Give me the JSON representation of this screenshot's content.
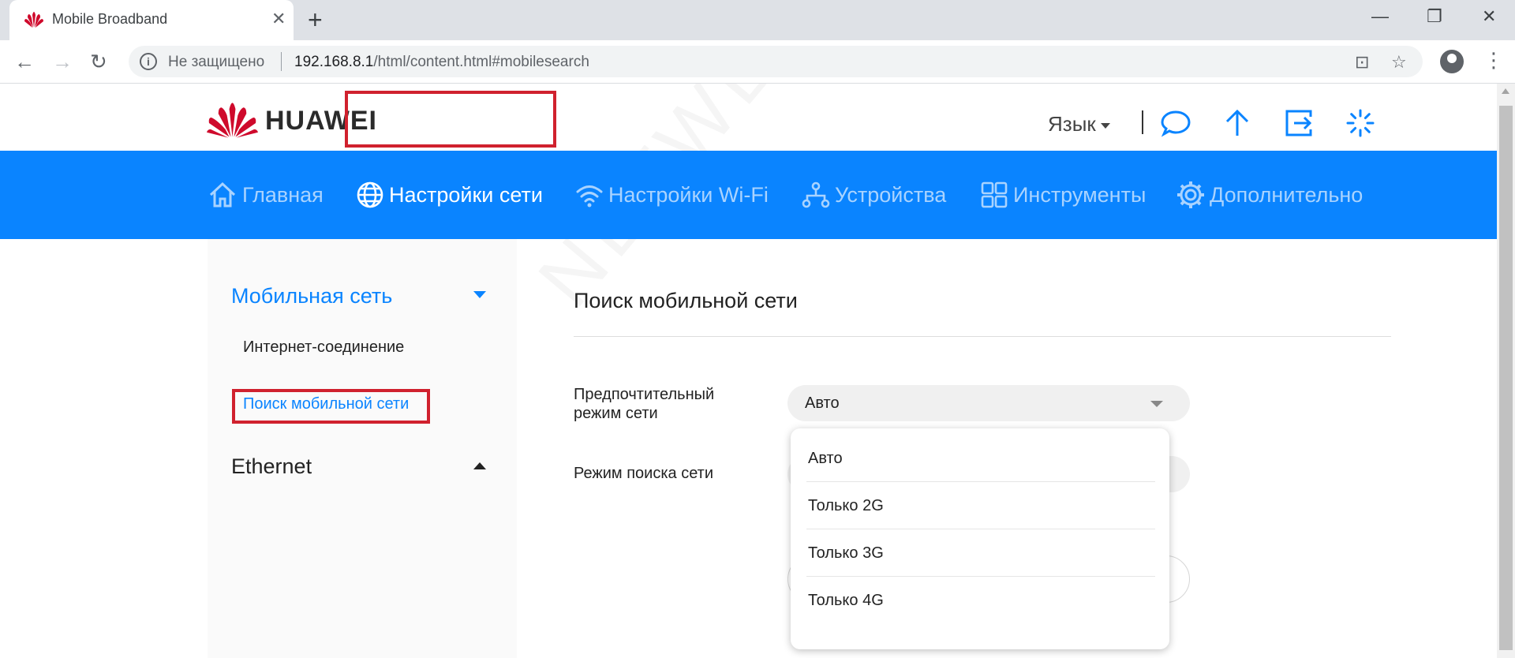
{
  "browser": {
    "tab_title": "Mobile Broadband",
    "close_glyph": "✕",
    "new_tab_glyph": "+",
    "window_minimize": "—",
    "window_restore": "❐",
    "window_close": "✕",
    "back_glyph": "←",
    "forward_glyph": "→",
    "reload_glyph": "↻",
    "info_glyph": "i",
    "security_label": "Не защищено",
    "url_host": "192.168.8.1",
    "url_path": "/html/content.html#mobilesearch",
    "translate_glyph": "⊡",
    "star_glyph": "☆",
    "menu_glyph": "⋮"
  },
  "header": {
    "brand": "HUAWEI",
    "language": "Язык"
  },
  "nav": {
    "items": [
      {
        "label": "Главная",
        "icon": "home-icon"
      },
      {
        "label": "Настройки сети",
        "icon": "globe-icon"
      },
      {
        "label": "Настройки Wi-Fi",
        "icon": "wifi-icon"
      },
      {
        "label": "Устройства",
        "icon": "devices-icon"
      },
      {
        "label": "Инструменты",
        "icon": "tools-icon"
      },
      {
        "label": "Дополнительно",
        "icon": "gear-icon"
      }
    ],
    "active_index": 1
  },
  "sidebar": {
    "groups": [
      {
        "label": "Мобильная сеть",
        "expanded": true,
        "items": [
          {
            "label": "Интернет-соединение"
          },
          {
            "label": "Поиск мобильной сети",
            "active": true
          }
        ]
      },
      {
        "label": "Ethernet",
        "expanded": false
      }
    ]
  },
  "content": {
    "title": "Поиск мобильной сети",
    "fields": [
      {
        "label_line1": "Предпочтительный",
        "label_line2": "режим сети",
        "value": "Авто"
      },
      {
        "label": "Режим поиска сети"
      }
    ],
    "dropdown_options": [
      "Авто",
      "Только 2G",
      "Только 3G",
      "Только 4G"
    ]
  },
  "colors": {
    "accent": "#0a84ff",
    "highlight_box": "#d0212e",
    "brand_red": "#cf0a2c"
  }
}
